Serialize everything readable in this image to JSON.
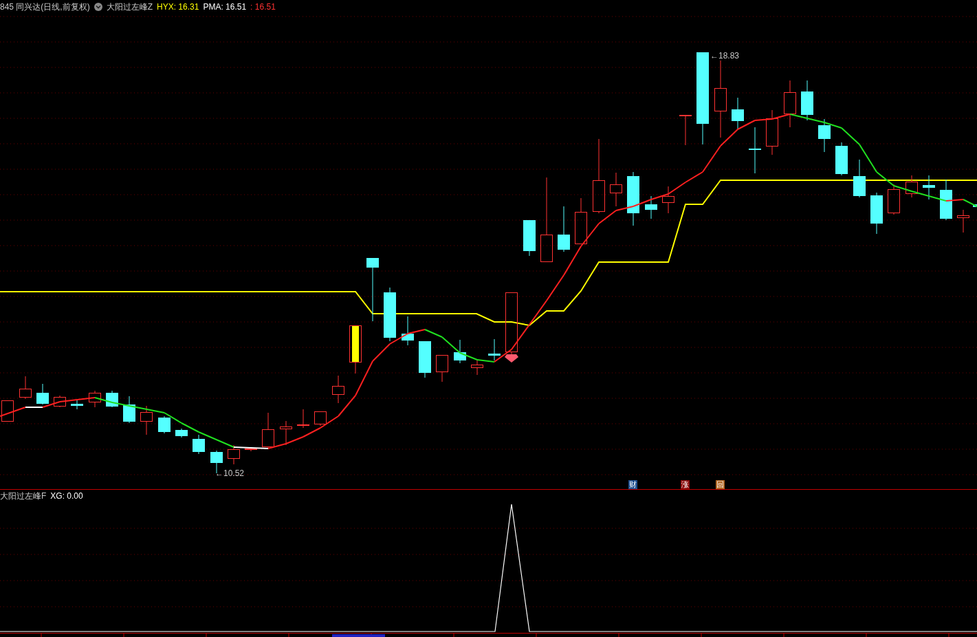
{
  "main_header": {
    "security": "845 同兴达(日线,前复权)",
    "indicator": "大阳过左峰Z",
    "values": [
      {
        "text": "HYX: 16.31",
        "color": "#ffff00"
      },
      {
        "text": "PMA: 16.51",
        "color": "#ffffff"
      },
      {
        "text": ": 16.51",
        "color": "#ff3232"
      }
    ]
  },
  "price_labels": [
    {
      "text": "←18.83"
    },
    {
      "text": "←10.52"
    }
  ],
  "markers": [
    {
      "text": "财",
      "color": "#1f4f8f"
    },
    {
      "text": "涨",
      "color": "#8a0a0a"
    },
    {
      "text": "回",
      "color": "#b0641e"
    }
  ],
  "sub_header": {
    "indicator": "大阳过左峰F",
    "values": [
      {
        "text": "XG: 0.00",
        "color": "#ffffff"
      }
    ]
  }
}
